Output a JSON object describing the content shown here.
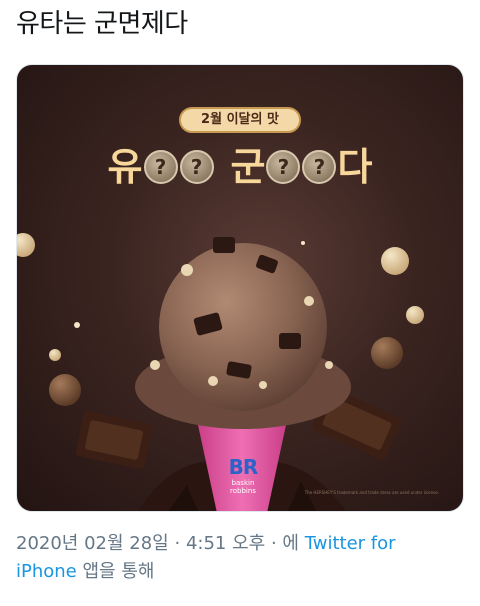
{
  "tweet": {
    "text": "유타는 군면제다"
  },
  "media": {
    "banner": "2월 이달의 맛",
    "headline": {
      "first_char": "유",
      "coin_mark": "?",
      "second_char": "군",
      "last_char": "다"
    },
    "fine_print": "The HERSHEY'S trademark and trade dress are used under license.",
    "logo": {
      "mark": "BR",
      "name_line1": "baskin",
      "name_line2": "robbins"
    },
    "colors": {
      "background": "#3a2420",
      "headline": "#f7d79a",
      "cone": "#e84f9e",
      "logo": "#2b63c9"
    }
  },
  "meta": {
    "timestamp": "2020년 02월 28일",
    "separator": "·",
    "time": "4:51 오후",
    "via_prefix": "에",
    "client": "Twitter for iPhone",
    "via_suffix": "앱을 통해"
  }
}
